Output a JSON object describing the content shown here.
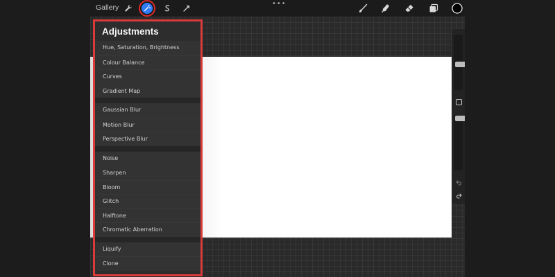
{
  "topbar": {
    "gallery_label": "Gallery",
    "tools": [
      {
        "icon": "wrench-icon"
      },
      {
        "icon": "magic-wand-icon",
        "active": true
      },
      {
        "icon": "selection-s-icon"
      },
      {
        "icon": "transform-arrow-icon"
      }
    ],
    "more_label": "•••",
    "right_tools": [
      {
        "icon": "brush-icon"
      },
      {
        "icon": "smudge-icon"
      },
      {
        "icon": "eraser-icon"
      },
      {
        "icon": "layers-icon"
      }
    ],
    "color_swatch": "#000000"
  },
  "adjustments": {
    "title": "Adjustments",
    "groups": [
      [
        "Hue, Saturation, Brightness",
        "Colour Balance",
        "Curves",
        "Gradient Map"
      ],
      [
        "Gaussian Blur",
        "Motion Blur",
        "Perspective Blur"
      ],
      [
        "Noise",
        "Sharpen",
        "Bloom",
        "Glitch",
        "Halftone",
        "Chromatic Aberration"
      ],
      [
        "Liquify",
        "Clone"
      ]
    ]
  },
  "colors": {
    "accent": "#2f7cf6",
    "highlight": "#d93a3a"
  }
}
